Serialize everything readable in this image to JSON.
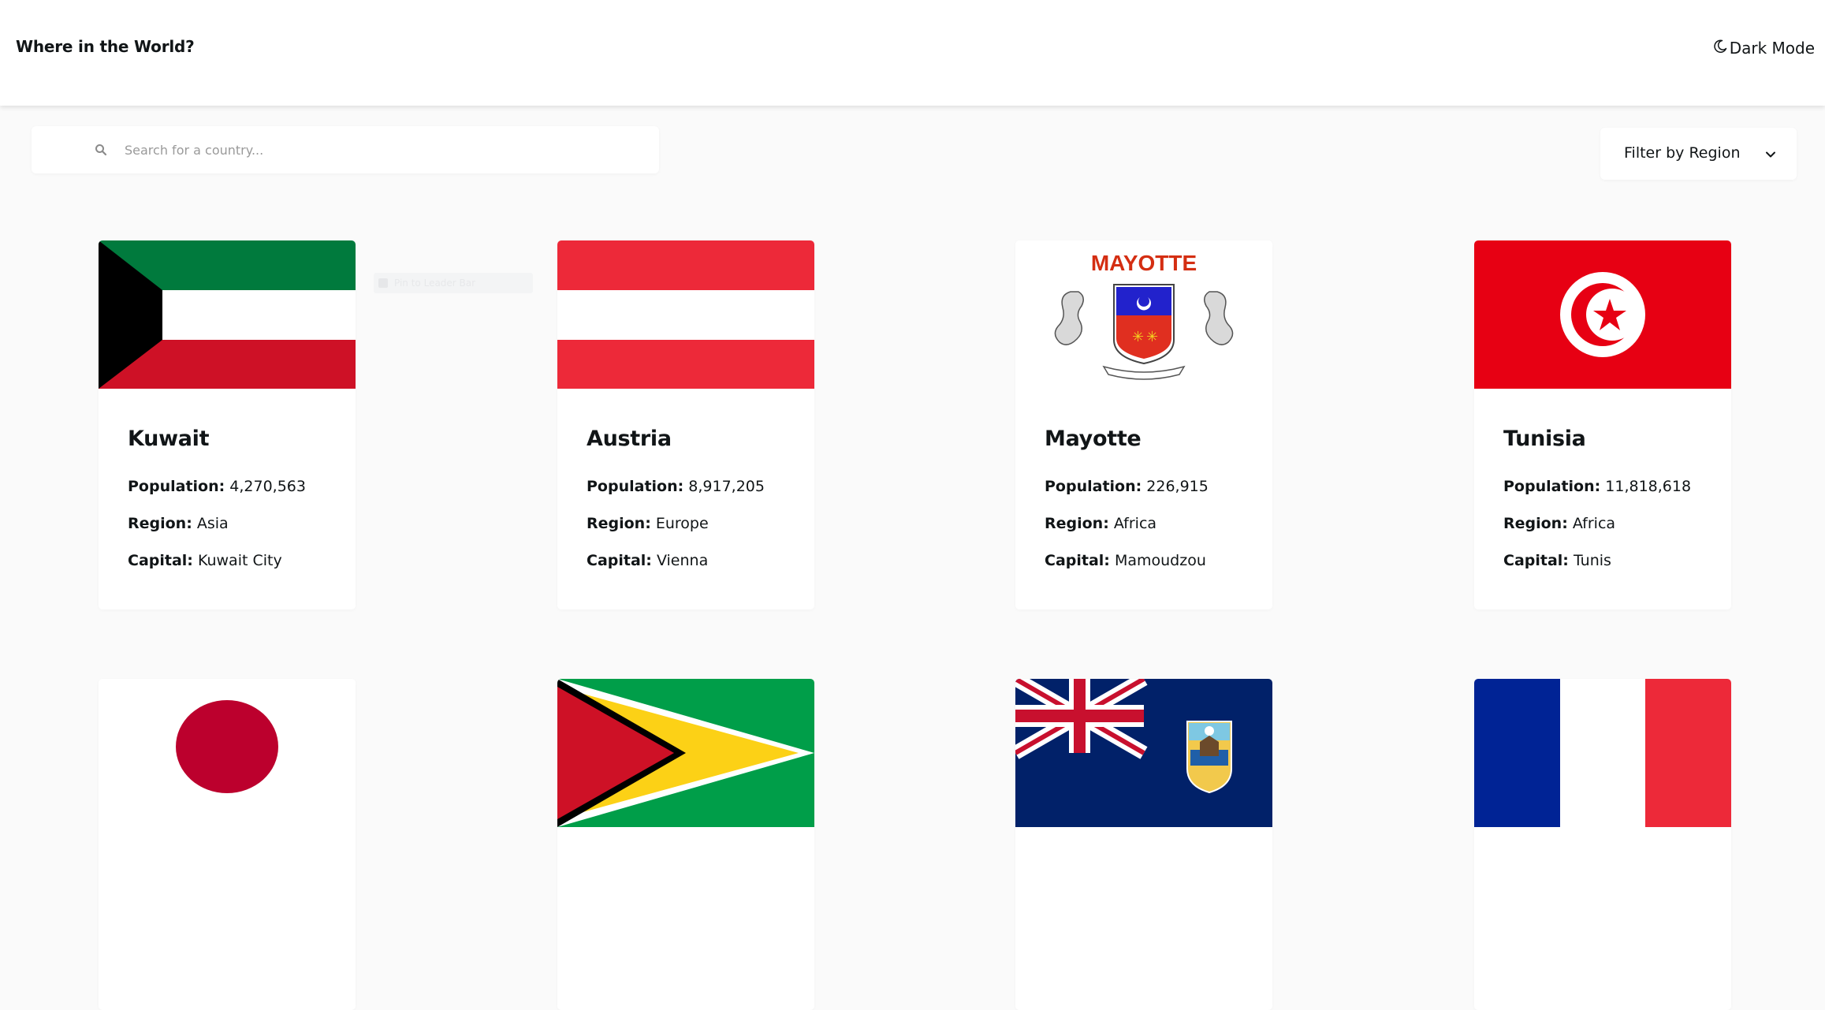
{
  "header": {
    "title": "Where in the World?",
    "theme_toggle_label": "Dark Mode",
    "theme_icon": "moon-icon"
  },
  "search": {
    "placeholder": "Search for a country...",
    "value": "",
    "icon": "search-icon"
  },
  "filter": {
    "label": "Filter by Region",
    "icon": "chevron-down-icon"
  },
  "ghost_tooltip": "Pin to Leader Bar",
  "labels": {
    "population": "Population:",
    "region": "Region:",
    "capital": "Capital:"
  },
  "countries": [
    {
      "name": "Kuwait",
      "population": "4,270,563",
      "region": "Asia",
      "capital": "Kuwait City"
    },
    {
      "name": "Austria",
      "population": "8,917,205",
      "region": "Europe",
      "capital": "Vienna"
    },
    {
      "name": "Mayotte",
      "population": "226,915",
      "region": "Africa",
      "capital": "Mamoudzou",
      "flag_text": "MAYOTTE"
    },
    {
      "name": "Tunisia",
      "population": "11,818,618",
      "region": "Africa",
      "capital": "Tunis"
    }
  ],
  "second_row_flags": [
    "japan-flag",
    "guyana-flag",
    "saint-helena-flag",
    "france-flag"
  ]
}
